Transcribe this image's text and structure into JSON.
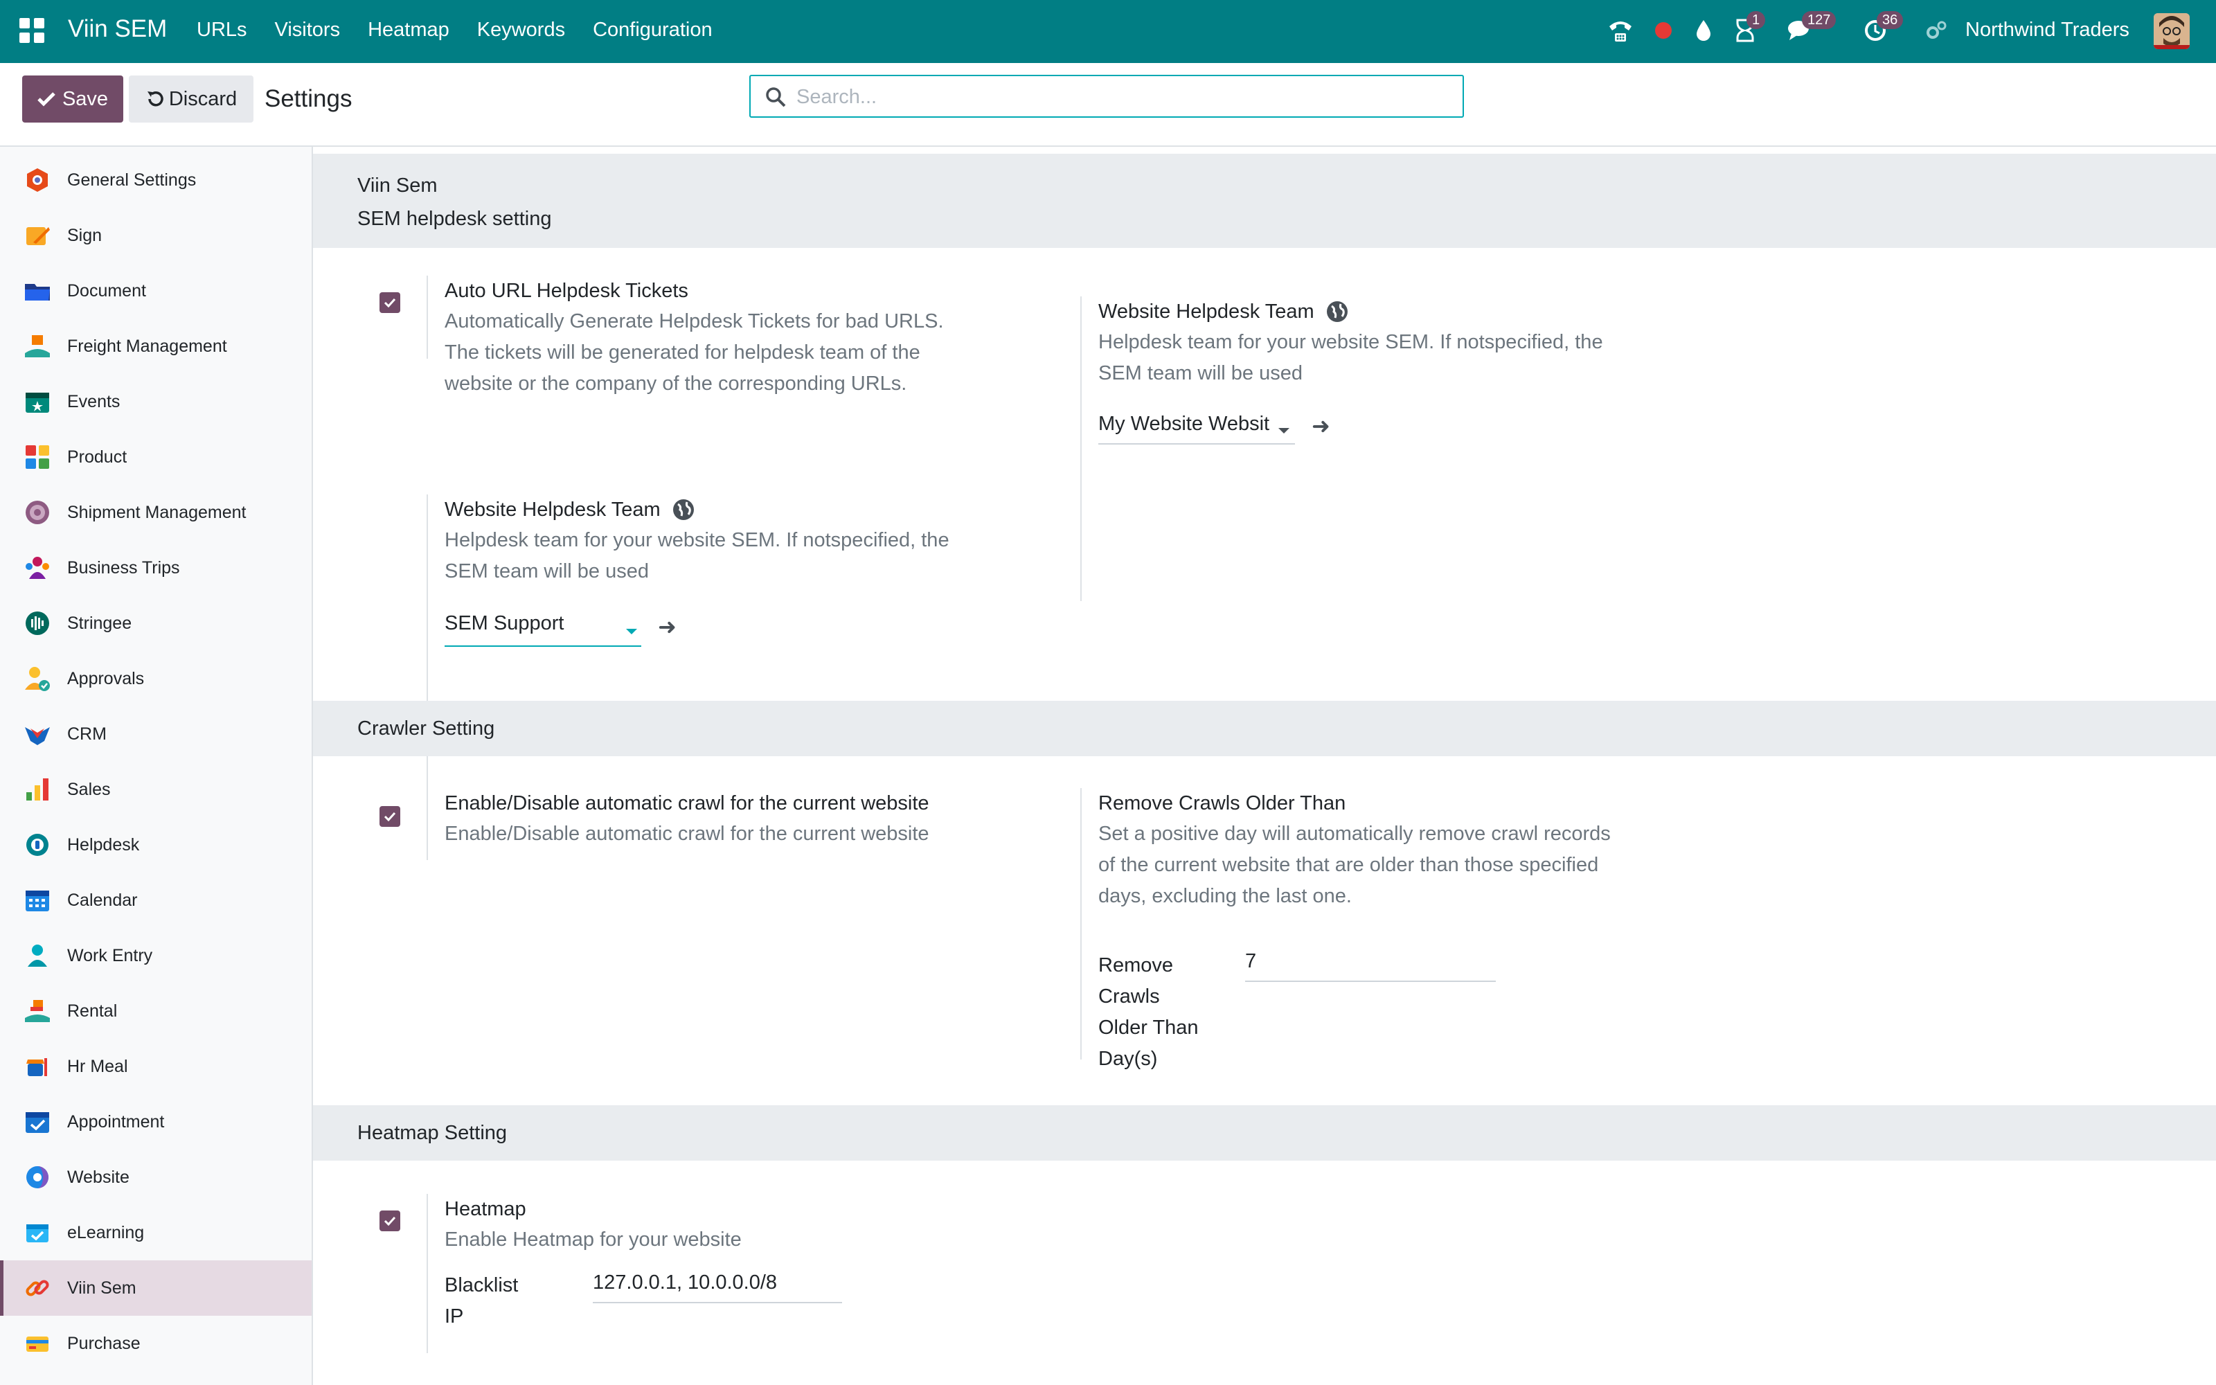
{
  "navbar": {
    "brand": "Viin SEM",
    "menu": [
      {
        "label": "URLs"
      },
      {
        "label": "Visitors"
      },
      {
        "label": "Heatmap"
      },
      {
        "label": "Keywords"
      },
      {
        "label": "Configuration"
      }
    ],
    "badges": {
      "activity": "1",
      "messages": "127",
      "timer": "36"
    },
    "company": "Northwind Traders"
  },
  "control_panel": {
    "save_label": "Save",
    "discard_label": "Discard",
    "title": "Settings",
    "search_placeholder": "Search..."
  },
  "sidebar": {
    "items": [
      {
        "label": "General Settings",
        "icon": "general-settings-icon"
      },
      {
        "label": "Sign",
        "icon": "sign-icon"
      },
      {
        "label": "Document",
        "icon": "document-icon"
      },
      {
        "label": "Freight Management",
        "icon": "freight-icon"
      },
      {
        "label": "Events",
        "icon": "events-icon"
      },
      {
        "label": "Product",
        "icon": "product-icon"
      },
      {
        "label": "Shipment Management",
        "icon": "shipment-icon"
      },
      {
        "label": "Business Trips",
        "icon": "business-trips-icon"
      },
      {
        "label": "Stringee",
        "icon": "stringee-icon"
      },
      {
        "label": "Approvals",
        "icon": "approvals-icon"
      },
      {
        "label": "CRM",
        "icon": "crm-icon"
      },
      {
        "label": "Sales",
        "icon": "sales-icon"
      },
      {
        "label": "Helpdesk",
        "icon": "helpdesk-icon"
      },
      {
        "label": "Calendar",
        "icon": "calendar-icon"
      },
      {
        "label": "Work Entry",
        "icon": "work-entry-icon"
      },
      {
        "label": "Rental",
        "icon": "rental-icon"
      },
      {
        "label": "Hr Meal",
        "icon": "hr-meal-icon"
      },
      {
        "label": "Appointment",
        "icon": "appointment-icon"
      },
      {
        "label": "Website",
        "icon": "website-icon"
      },
      {
        "label": "eLearning",
        "icon": "elearning-icon"
      },
      {
        "label": "Viin Sem",
        "icon": "viin-sem-icon",
        "active": true
      },
      {
        "label": "Purchase",
        "icon": "purchase-icon"
      }
    ]
  },
  "main": {
    "app_title": "Viin Sem",
    "sem_helpdesk": {
      "heading": "SEM helpdesk setting",
      "auto_url": {
        "title": "Auto URL Helpdesk Tickets",
        "desc_lines": [
          "Automatically Generate Helpdesk Tickets for bad URLS.",
          "The tickets will be generated for helpdesk team of the",
          "website or the company of the corresponding URLs."
        ],
        "checked": true
      },
      "website_team_right": {
        "title": "Website Helpdesk Team",
        "desc_lines": [
          "Helpdesk team for your website SEM. If notspecified, the",
          "SEM team will be used"
        ],
        "value": "My Website Websit"
      },
      "website_team_left": {
        "title": "Website Helpdesk Team",
        "desc_lines": [
          "Helpdesk team for your website SEM. If notspecified, the",
          "SEM team will be used"
        ],
        "value": "SEM Support"
      }
    },
    "crawler": {
      "heading": "Crawler Setting",
      "auto_crawl": {
        "title": "Enable/Disable automatic crawl for the current website",
        "desc": "Enable/Disable automatic crawl for the current website",
        "checked": true
      },
      "remove_crawls": {
        "title": "Remove Crawls Older Than",
        "desc_lines": [
          "Set a positive day will automatically remove crawl records",
          "of the current website that are older than those specified",
          "days, excluding the last one."
        ],
        "field_label_lines": [
          "Remove",
          "Crawls",
          "Older Than",
          "Day(s)"
        ],
        "value": "7"
      }
    },
    "heatmap": {
      "heading": "Heatmap Setting",
      "enable": {
        "title": "Heatmap",
        "desc": "Enable Heatmap for your website",
        "checked": true
      },
      "blacklist": {
        "label_lines": [
          "Blacklist",
          "IP"
        ],
        "value": "127.0.0.1, 10.0.0.0/8"
      }
    }
  },
  "colors": {
    "navbar": "#017e84",
    "primary": "#714b67",
    "section_bg": "#e9ecef",
    "muted_text": "#6c757d"
  }
}
